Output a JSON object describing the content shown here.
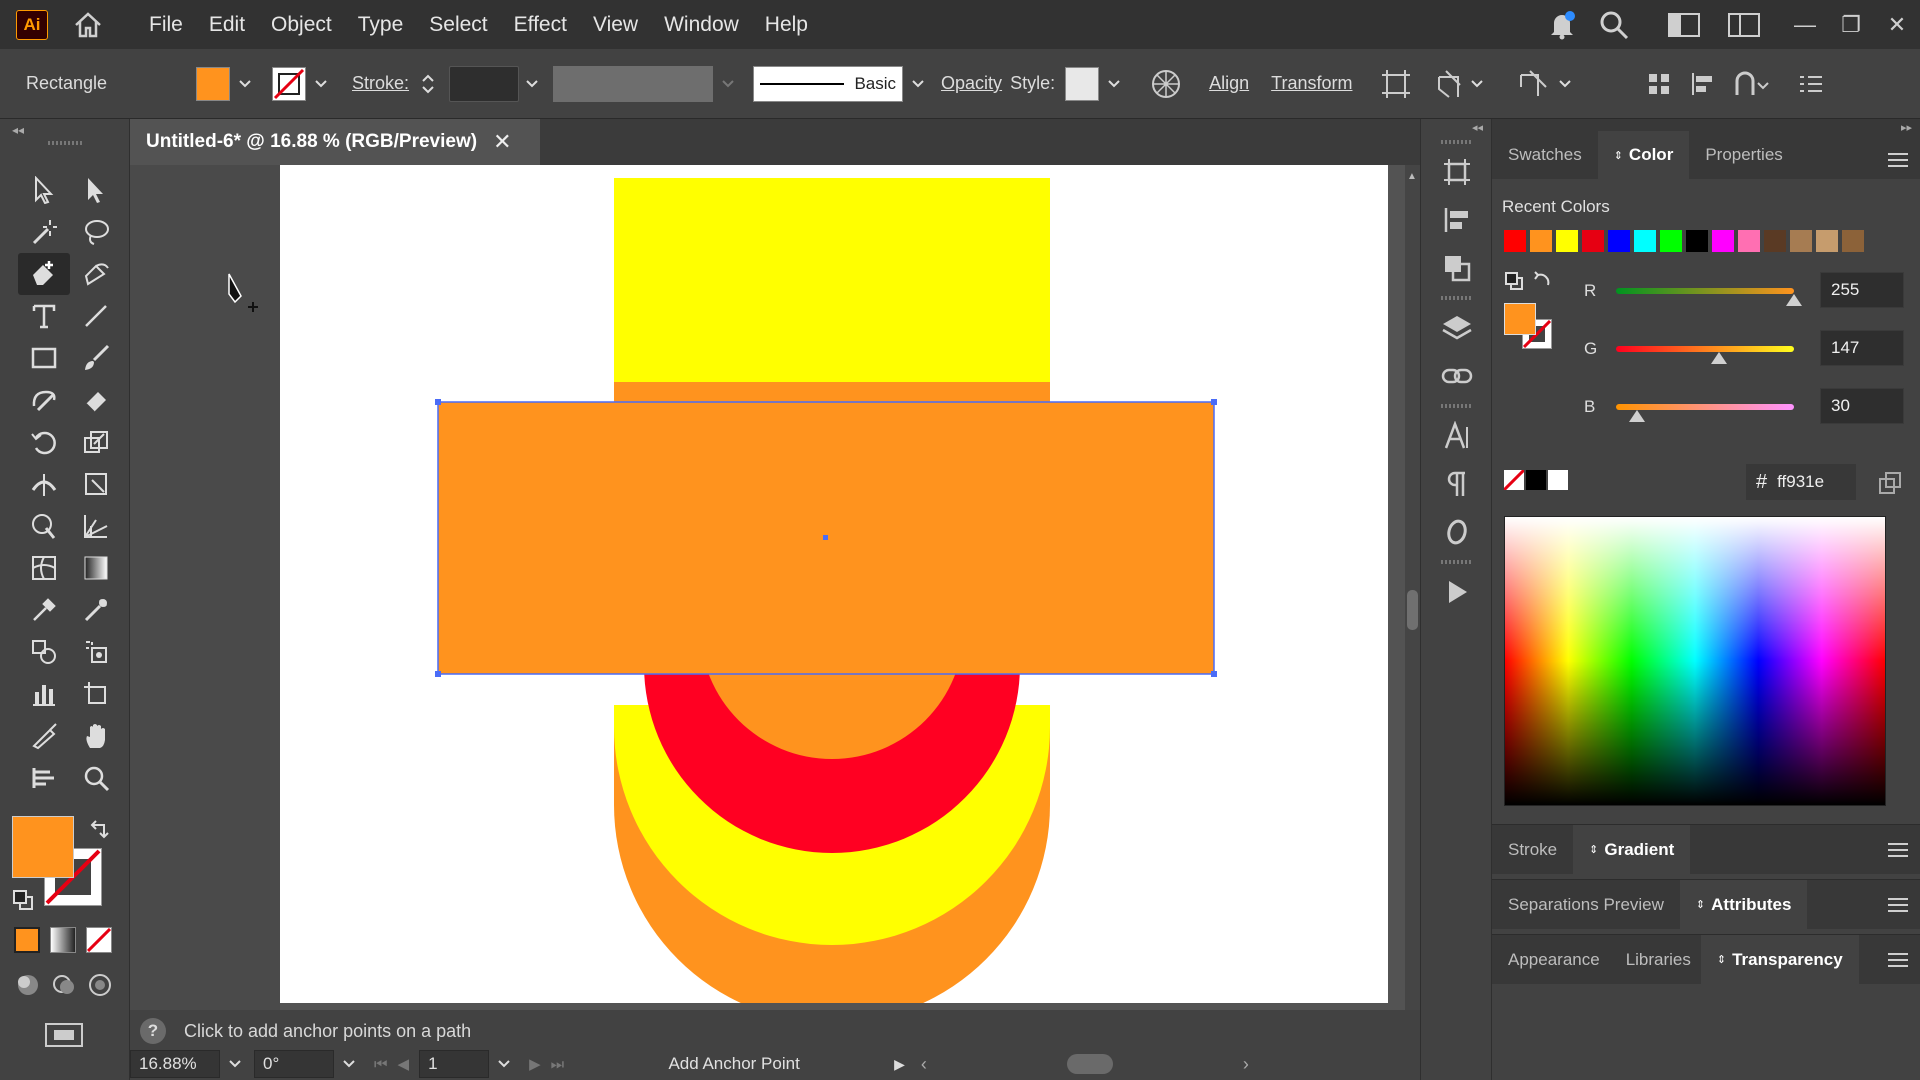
{
  "app": {
    "logo": "Ai"
  },
  "menu": [
    "File",
    "Edit",
    "Object",
    "Type",
    "Select",
    "Effect",
    "View",
    "Window",
    "Help"
  ],
  "control_bar": {
    "selection_type": "Rectangle",
    "fill_color": "#ff931e",
    "stroke_label": "Stroke:",
    "stroke_style": "Basic",
    "opacity_label": "Opacity",
    "style_label": "Style:",
    "align_label": "Align",
    "transform_label": "Transform"
  },
  "document": {
    "tab_title": "Untitled-6* @ 16.88 % (RGB/Preview)",
    "close_glyph": "✕"
  },
  "status": {
    "hint": "Click to add anchor points on a path",
    "zoom": "16.88%",
    "rotation": "0°",
    "artboard_number": "1",
    "current_tool": "Add Anchor Point"
  },
  "right_panel": {
    "tabs": [
      "Swatches",
      "Color",
      "Properties"
    ],
    "active_tab": "Color",
    "recent_colors_label": "Recent Colors",
    "recent_colors": [
      "#ff0000",
      "#ff931e",
      "#ffff00",
      "#e60012",
      "#0000ff",
      "#00ffff",
      "#00ff00",
      "#000000",
      "#ff00ff",
      "#ff6fb2",
      "#5a3a24",
      "#a67c52",
      "#c69c6d",
      "#8c6239"
    ],
    "r_label": "R",
    "r_value": "255",
    "g_label": "G",
    "g_value": "147",
    "b_label": "B",
    "b_value": "30",
    "r_level": 1.0,
    "g_level": 0.576,
    "b_level": 0.118,
    "hex_label": "#",
    "hex_value": "ff931e",
    "panel_groups": [
      {
        "tabs": [
          "Stroke",
          "Gradient"
        ],
        "active": "Gradient"
      },
      {
        "tabs": [
          "Separations Preview",
          "Attributes"
        ],
        "active": "Attributes"
      },
      {
        "tabs": [
          "Appearance",
          "Libraries",
          "Transparency"
        ],
        "active": "Transparency"
      }
    ]
  },
  "colors": {
    "orange": "#ff931e",
    "yellow": "#ffff00",
    "red": "#ff0022",
    "selection": "#4a6cf7"
  }
}
